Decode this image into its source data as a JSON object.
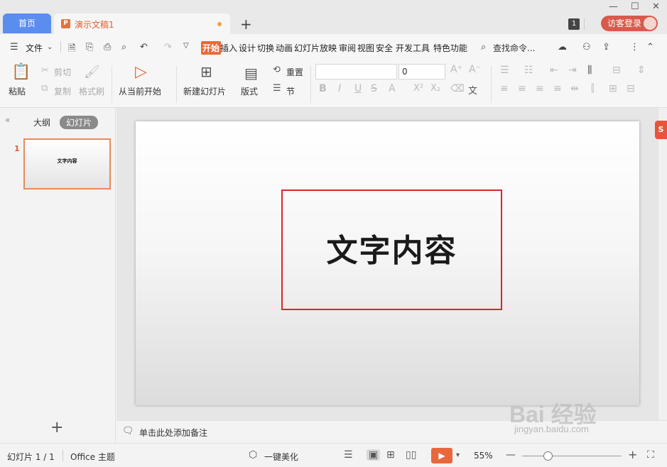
{
  "tabs": {
    "home": "首页",
    "doc_title": "演示文稿1"
  },
  "titlebar": {
    "window_count": "1",
    "login": "访客登录"
  },
  "menu": {
    "file": "文件",
    "items": [
      "开始",
      "插入",
      "设计",
      "切换",
      "动画",
      "幻灯片放映",
      "审阅",
      "视图",
      "安全",
      "开发工具",
      "特色功能"
    ],
    "search": "查找命令..."
  },
  "ribbon": {
    "paste": "粘贴",
    "cut": "剪切",
    "copy": "复制",
    "format_painter": "格式刷",
    "from_current": "从当前开始",
    "new_slide": "新建幻灯片",
    "layout": "版式",
    "reset": "重置",
    "section": "节",
    "font_size": "0"
  },
  "left_pane": {
    "outline": "大纲",
    "slides": "幻灯片",
    "slide_number": "1",
    "thumb_text": "文字内容"
  },
  "slide": {
    "text": "文字内容"
  },
  "notes": {
    "placeholder": "单击此处添加备注"
  },
  "watermark": {
    "main": "Bai 经验",
    "sub": "jingyan.baidu.com"
  },
  "statusbar": {
    "slide_info": "幻灯片 1 / 1",
    "theme": "Office 主题",
    "beautify": "一键美化",
    "zoom": "55%"
  },
  "colors": {
    "accent": "#e9683b",
    "home_tab": "#5b8def",
    "selection": "#d9262a"
  }
}
